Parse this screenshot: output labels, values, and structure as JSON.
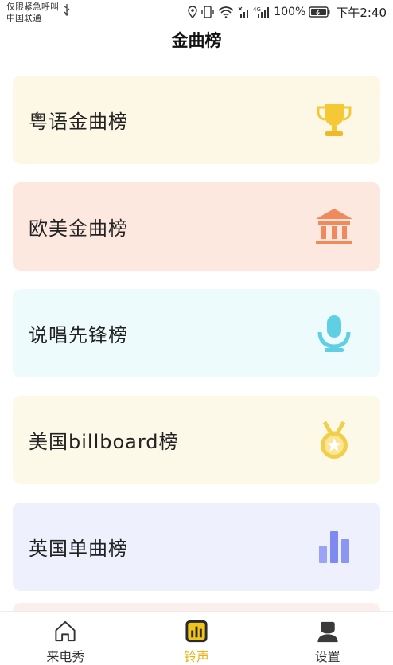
{
  "status_bar": {
    "carrier_line1": "仅限紧急呼叫",
    "carrier_line2": "中国联通",
    "network": "4G",
    "battery": "100%",
    "time": "下午2:40"
  },
  "header": {
    "title": "金曲榜"
  },
  "charts": [
    {
      "label": "粤语金曲榜",
      "icon": "trophy-icon",
      "bg": "#fdf7e6",
      "icon_color": "#f5c836"
    },
    {
      "label": "欧美金曲榜",
      "icon": "bank-icon",
      "bg": "#fde8e0",
      "icon_color": "#f08a5d"
    },
    {
      "label": "说唱先锋榜",
      "icon": "microphone-icon",
      "bg": "#eefbfd",
      "icon_color": "#5fd0e4"
    },
    {
      "label": "美国billboard榜",
      "icon": "medal-icon",
      "bg": "#fdf9e9",
      "icon_color": "#f2cf4a"
    },
    {
      "label": "英国单曲榜",
      "icon": "bar-chart-icon",
      "bg": "#eef0fd",
      "icon_color": "#8b95f2"
    }
  ],
  "bottom_nav": [
    {
      "label": "来电秀",
      "icon": "home-icon",
      "active": false
    },
    {
      "label": "铃声",
      "icon": "ringtone-chart-icon",
      "active": true
    },
    {
      "label": "设置",
      "icon": "user-icon",
      "active": false
    }
  ],
  "colors": {
    "accent": "#e8b415"
  }
}
